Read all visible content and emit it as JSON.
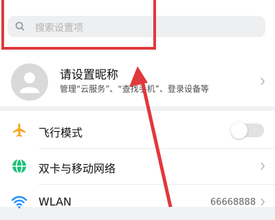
{
  "search": {
    "placeholder": "搜索设置项",
    "icon": "search-icon"
  },
  "profile": {
    "name": "请设置昵称",
    "subtitle": "管理“云服务”、“查找手机”、登录设备等",
    "avatar_icon": "person-icon"
  },
  "settings": {
    "items": [
      {
        "label": "飞行模式",
        "icon": "airplane-icon",
        "control": "toggle",
        "toggle_on": false
      },
      {
        "label": "双卡与移动网络",
        "icon": "globe-icon",
        "control": "chevron"
      },
      {
        "label": "WLAN",
        "icon": "wifi-icon",
        "value": "66668888",
        "control": "chevron"
      }
    ]
  },
  "annotation": {
    "color": "#e0383c"
  },
  "colors": {
    "accent_orange": "#f5a623",
    "network_green": "#1fbf7a",
    "wifi_blue": "#1e8fff"
  }
}
